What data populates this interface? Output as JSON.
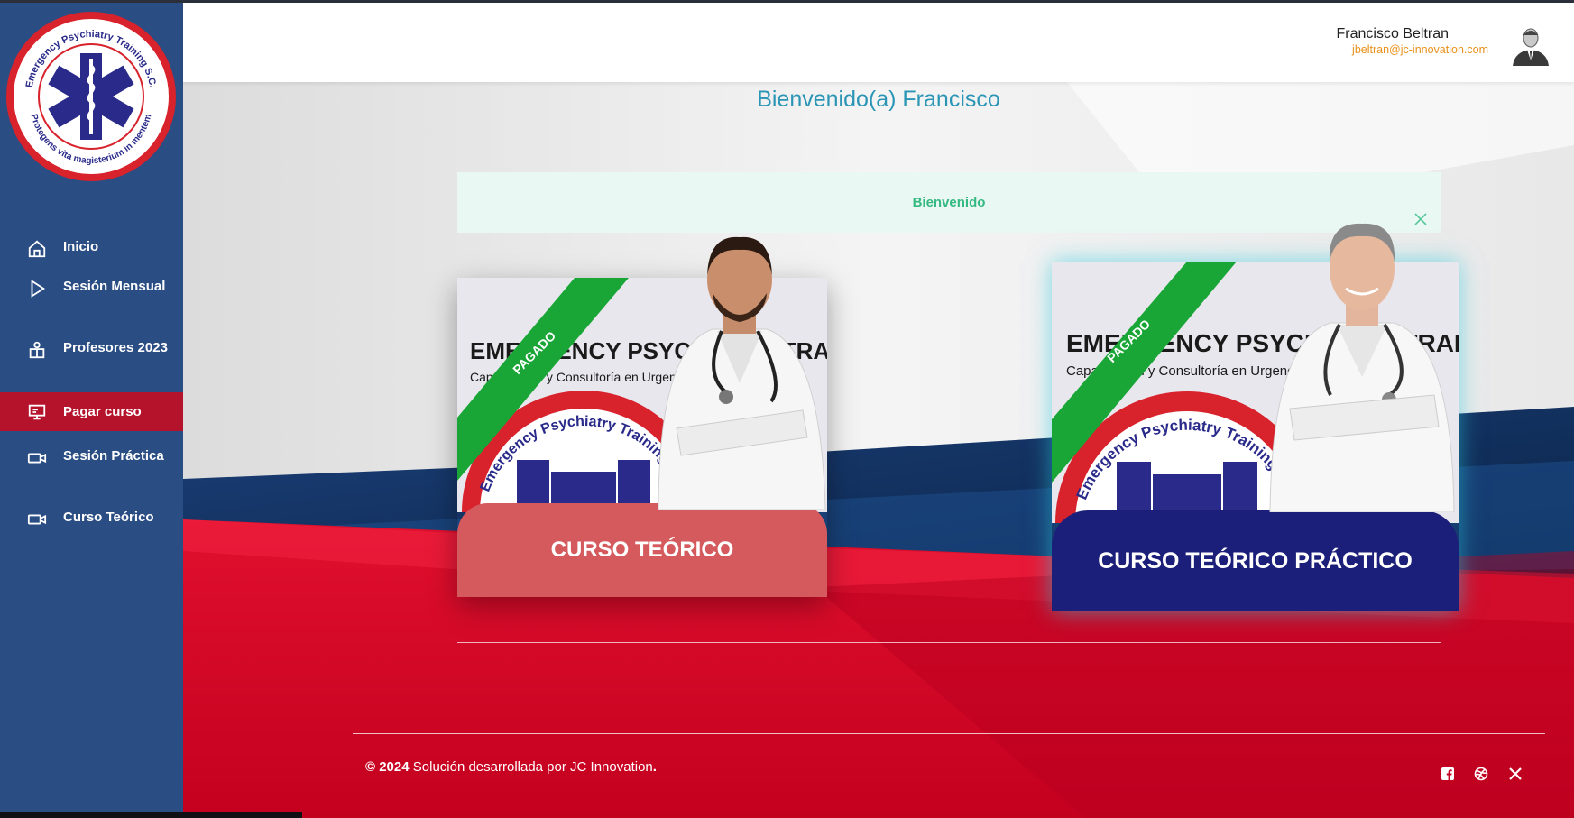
{
  "sidebar": {
    "logo_text_top": "Emergency Psychiatry Training S.C.",
    "logo_text_bottom": "Protegens vita magisterium in mentem",
    "items": [
      {
        "label": "Inicio",
        "icon": "home-icon"
      },
      {
        "label": "Sesión Mensual",
        "icon": "play-icon"
      },
      {
        "label": "Profesores 2023",
        "icon": "teacher-icon"
      },
      {
        "label": "Pagar curso",
        "icon": "presentation-icon",
        "active": true
      },
      {
        "label": "Sesión Práctica",
        "icon": "video-camera-icon"
      },
      {
        "label": "Curso Teórico",
        "icon": "video-camera-icon"
      }
    ]
  },
  "header": {
    "user_name": "Francisco Beltran",
    "user_email": "jbeltran@jc-innovation.com"
  },
  "main": {
    "welcome": "Bienvenido(a) Francisco",
    "alert_text": "Bienvenido",
    "cards": [
      {
        "title": "CURSO TEÓRICO",
        "badge": "PAGADO",
        "banner_title": "EMERGENCY PSYCHIATRY TRAINING",
        "banner_sub": "Capacitación y Consultoría en Urgencias",
        "circle_text": "Emergency Psychiatry Training S.C."
      },
      {
        "title": "CURSO TEÓRICO PRÁCTICO",
        "badge": "PAGADO",
        "banner_title": "EMERGENCY PSYCHIATRY TRAINING",
        "banner_sub": "Capacitación y Consultoría en Urgencias",
        "circle_text": "Emergency Psychiatry Training S.C."
      }
    ]
  },
  "footer": {
    "year": "© 2024",
    "text": " Solución desarrollada por JC Innovation",
    "dot": ".",
    "social": [
      "facebook-icon",
      "dribbble-icon",
      "x-twitter-icon"
    ]
  },
  "colors": {
    "sidebar": "#2a4d83",
    "active": "#b5132b",
    "welcome": "#2b95b5",
    "alert_bg": "#eaf8f3",
    "alert_text": "#35b982",
    "email": "#e8911b",
    "card1_btn": "#d55a5d",
    "card2_btn": "#1b1f7a",
    "badge": "#1aa637"
  }
}
